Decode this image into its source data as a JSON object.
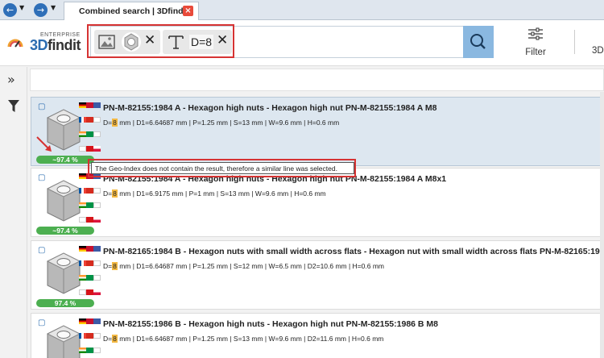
{
  "titlebar": {
    "back_icon": "arrow-left-icon",
    "forward_icon": "arrow-right-icon",
    "tab_label": "Combined search | 3Dfindit",
    "tab_close_icon": "close-icon"
  },
  "header": {
    "logo_small": "ENTERPRISE",
    "logo_prefix": "3D",
    "logo_suffix": "findit",
    "chips": {
      "image_chip_icons": [
        "image-icon",
        "nut-thumbnail-icon"
      ],
      "text_chip_icon": "text-icon",
      "text_chip_value": "D=8",
      "remove_icon": "close-icon"
    },
    "search_icon": "search-icon",
    "filter_label": "Filter",
    "filter_icon": "sliders-icon",
    "next_label": "3D"
  },
  "sidebar": {
    "expand_icon": "double-chevron-right-icon",
    "filter_icon": "funnel-icon"
  },
  "tooltip": "The Geo-Index does not contain the result, therefore a similar line was selected.",
  "results": [
    {
      "title": "PN-M-82155:1984 A - Hexagon high nuts - Hexagon high nut PN-M-82155:1984 A M8",
      "d_label": "D=",
      "d_value": "8",
      "rest": " mm | D1=6.64687 mm | P=1.25 mm | S=13 mm | W=9.6 mm | H=0.6 mm",
      "match": "~97.4 %"
    },
    {
      "title": "PN-M-82155:1984 A - Hexagon high nuts - Hexagon high nut PN-M-82155:1984 A M8x1",
      "d_label": "D=",
      "d_value": "8",
      "rest": " mm | D1=6.9175 mm | P=1 mm | S=13 mm | W=9.6 mm | H=0.6 mm",
      "match": "~97.4 %"
    },
    {
      "title": "PN-M-82165:1984 B - Hexagon nuts with small width across flats - Hexagon nut with small width across flats PN-M-82165:1984 B M8",
      "d_label": "D=",
      "d_value": "8",
      "rest": " mm | D1=6.64687 mm | P=1.25 mm | S=12 mm | W=6.5 mm | D2=10.6 mm | H=0.6 mm",
      "match": "97.4 %"
    },
    {
      "title": "PN-M-82155:1986 B - Hexagon high nuts - Hexagon high nut PN-M-82155:1986 B M8",
      "d_label": "D=",
      "d_value": "8",
      "rest": " mm | D1=6.64687 mm | P=1.25 mm | S=13 mm | W=9.6 mm | D2=11.6 mm | H=0.6 mm",
      "match": ""
    }
  ],
  "colors": {
    "accent": "#2b6cb0",
    "highlight_border": "#d63333",
    "match_green": "#4caf50",
    "value_highlight": "#f4b942"
  }
}
